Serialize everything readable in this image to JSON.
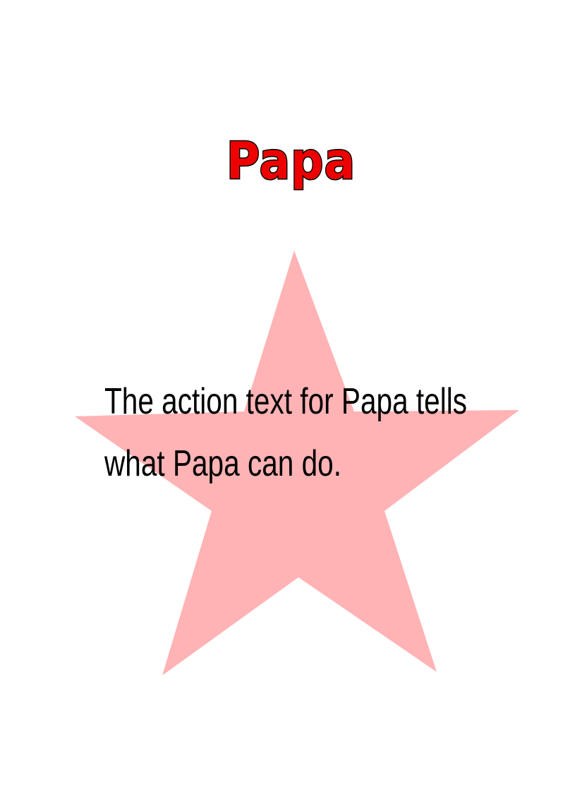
{
  "card": {
    "title": "Papa",
    "action_line_1": "The action text for Papa tells",
    "action_line_2": "what Papa can do.",
    "title_color": "#ee0000",
    "star_color": "#ffb3b5",
    "background_color": "#ffffff"
  }
}
